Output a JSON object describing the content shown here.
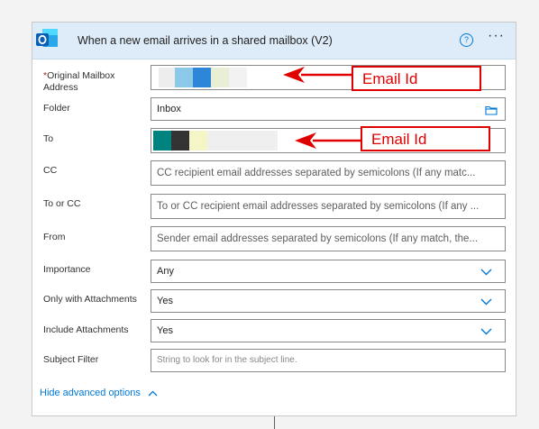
{
  "header": {
    "title": "When a new email arrives in a shared mailbox (V2)",
    "help_glyph": "?",
    "more_glyph": "···"
  },
  "fields": {
    "original_mailbox": {
      "label_required_mark": "*",
      "label_line1": "Original Mailbox",
      "label_line2": "Address"
    },
    "folder": {
      "label": "Folder",
      "value": "Inbox"
    },
    "to": {
      "label": "To"
    },
    "cc": {
      "label": "CC",
      "placeholder": "CC recipient email addresses separated by semicolons (If any matc..."
    },
    "to_or_cc": {
      "label": "To or CC",
      "placeholder": "To or CC recipient email addresses separated by semicolons (If any ..."
    },
    "from": {
      "label": "From",
      "placeholder": "Sender email addresses separated by semicolons (If any match, the..."
    },
    "importance": {
      "label": "Importance",
      "value": "Any"
    },
    "only_with_attachments": {
      "label": "Only with Attachments",
      "value": "Yes"
    },
    "include_attachments": {
      "label": "Include Attachments",
      "value": "Yes"
    },
    "subject_filter": {
      "label": "Subject Filter",
      "placeholder": "String to look for in the subject line."
    }
  },
  "footer": {
    "hide_advanced_label": "Hide advanced options"
  },
  "annotations": [
    {
      "text": "Email Id"
    },
    {
      "text": "Email Id"
    }
  ],
  "colors": {
    "header_bg": "#deecf9",
    "accent": "#0078d4",
    "annotation": "#e00000",
    "redacted_blocks_mailbox": [
      "#ededed",
      "#8cc8e8",
      "#2e86d8",
      "#e9efd4"
    ],
    "redacted_blocks_to": [
      "#00827f",
      "#333333",
      "#f5f5c8",
      "#efefef"
    ]
  },
  "icons": [
    "outlook-icon",
    "help-icon",
    "more-options-icon",
    "folder-icon",
    "chevron-down-icon",
    "chevron-up-icon"
  ]
}
